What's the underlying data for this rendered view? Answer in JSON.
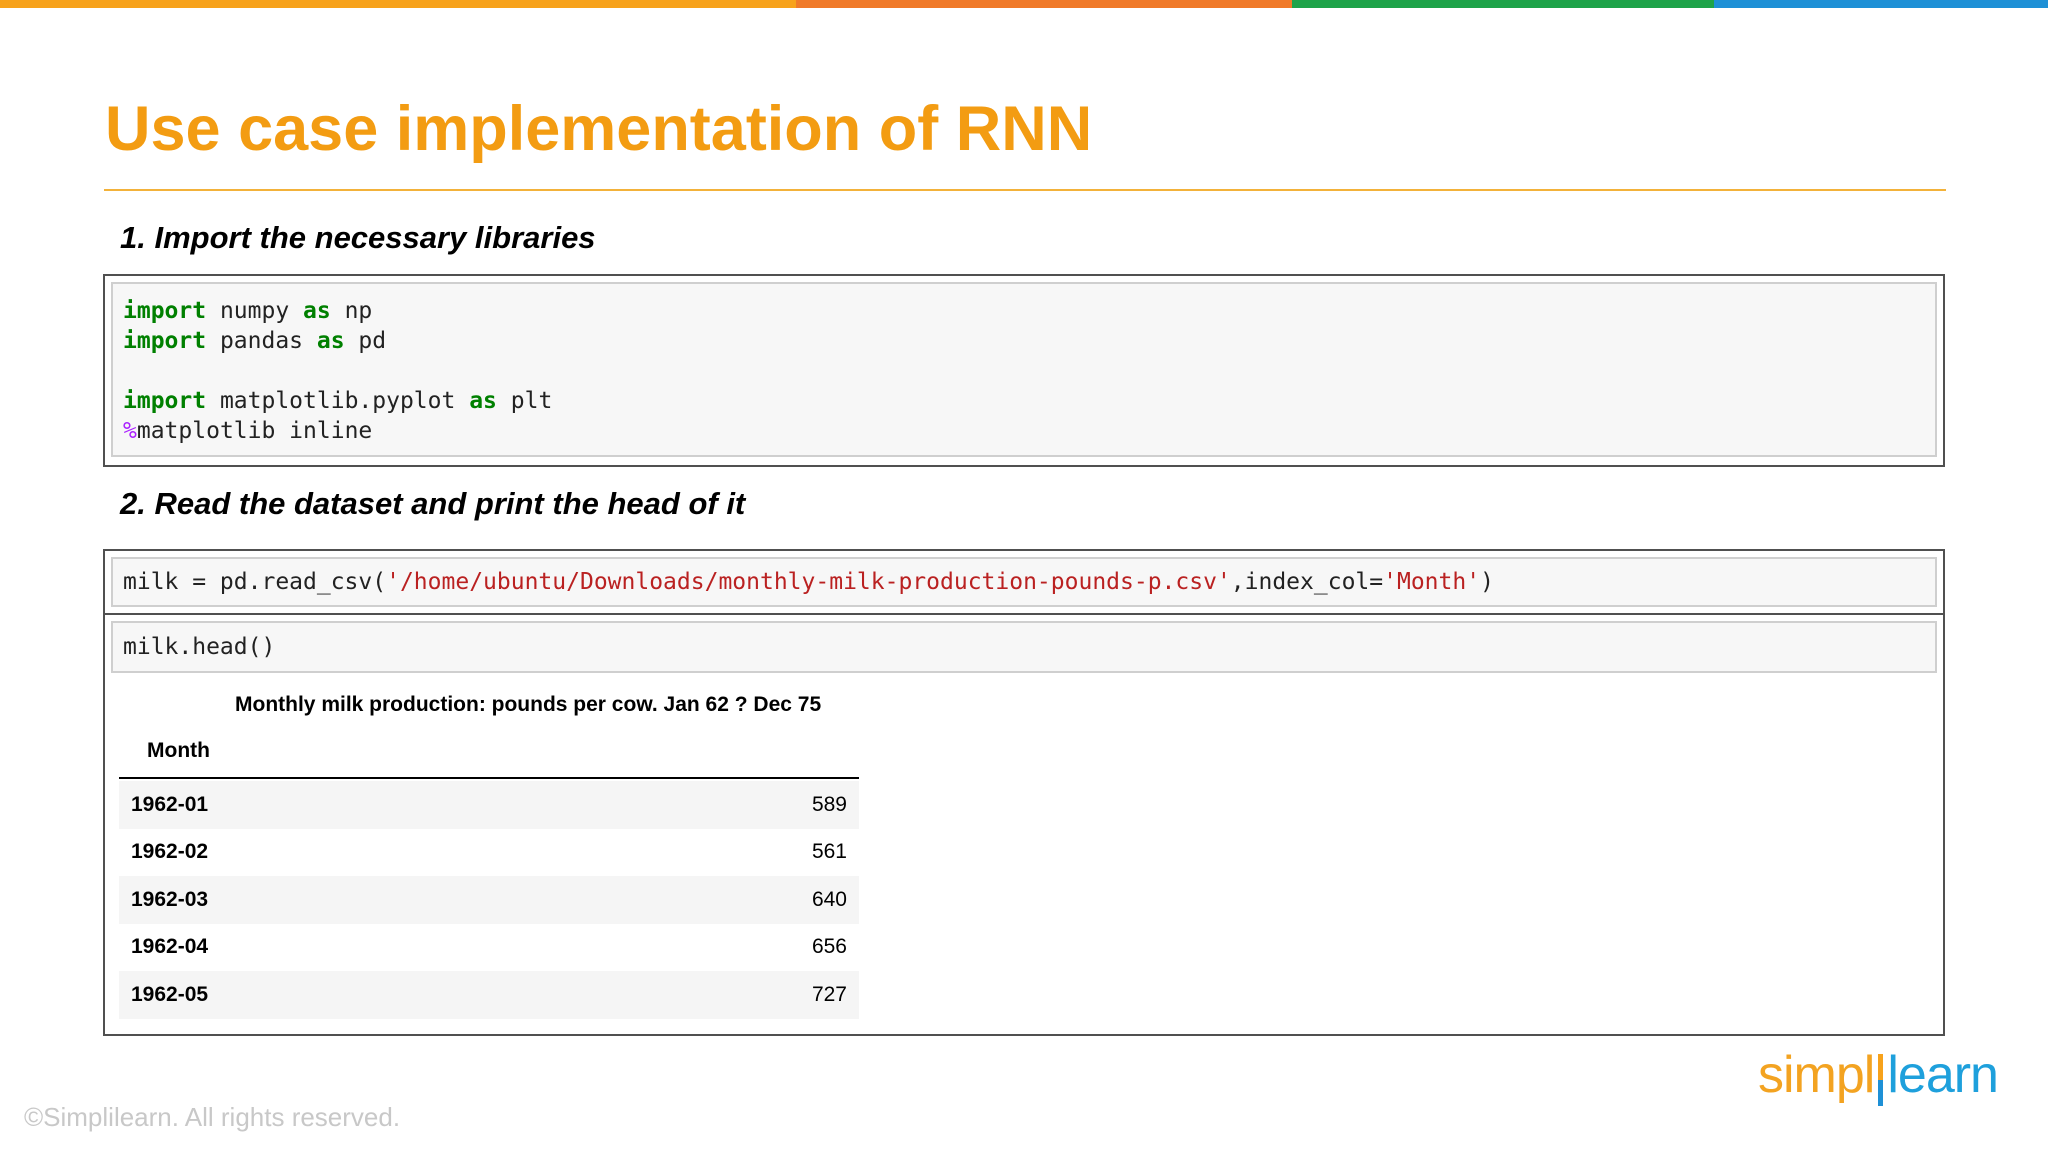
{
  "colors": {
    "bar1": "#f7a21b",
    "bar2": "#f07a29",
    "bar3": "#1ea349",
    "bar4": "#1e90d6",
    "title": "#f39c12",
    "rule": "#f3b23a"
  },
  "slide": {
    "title": "Use case implementation of RNN",
    "copyright": "©Simplilearn. All rights reserved."
  },
  "logo": {
    "part1": "simpl",
    "part2": "learn"
  },
  "section1": {
    "heading": "1. Import the necessary libraries",
    "code": [
      {
        "kw": "import",
        "rest": " numpy ",
        "kw2": "as",
        "rest2": " np"
      },
      {
        "kw": "import",
        "rest": " pandas ",
        "kw2": "as",
        "rest2": " pd"
      },
      {
        "kw": "import",
        "rest": " matplotlib.pyplot ",
        "kw2": "as",
        "rest2": " plt"
      },
      {
        "magic": "%",
        "rest": "matplotlib inline"
      }
    ]
  },
  "section2": {
    "heading": "2. Read the dataset and print the head of it",
    "read_code": {
      "prefix": "milk = pd.read_csv(",
      "path": "'/home/ubuntu/Downloads/monthly-milk-production-pounds-p.csv'",
      "middle": ",index_col=",
      "col": "'Month'",
      "suffix": ")"
    },
    "head_code": "milk.head()",
    "dataframe": {
      "column": "Monthly milk production: pounds per cow. Jan 62 ? Dec 75",
      "index_name": "Month",
      "rows": [
        {
          "index": "1962-01",
          "value": "589"
        },
        {
          "index": "1962-02",
          "value": "561"
        },
        {
          "index": "1962-03",
          "value": "640"
        },
        {
          "index": "1962-04",
          "value": "656"
        },
        {
          "index": "1962-05",
          "value": "727"
        }
      ]
    }
  }
}
